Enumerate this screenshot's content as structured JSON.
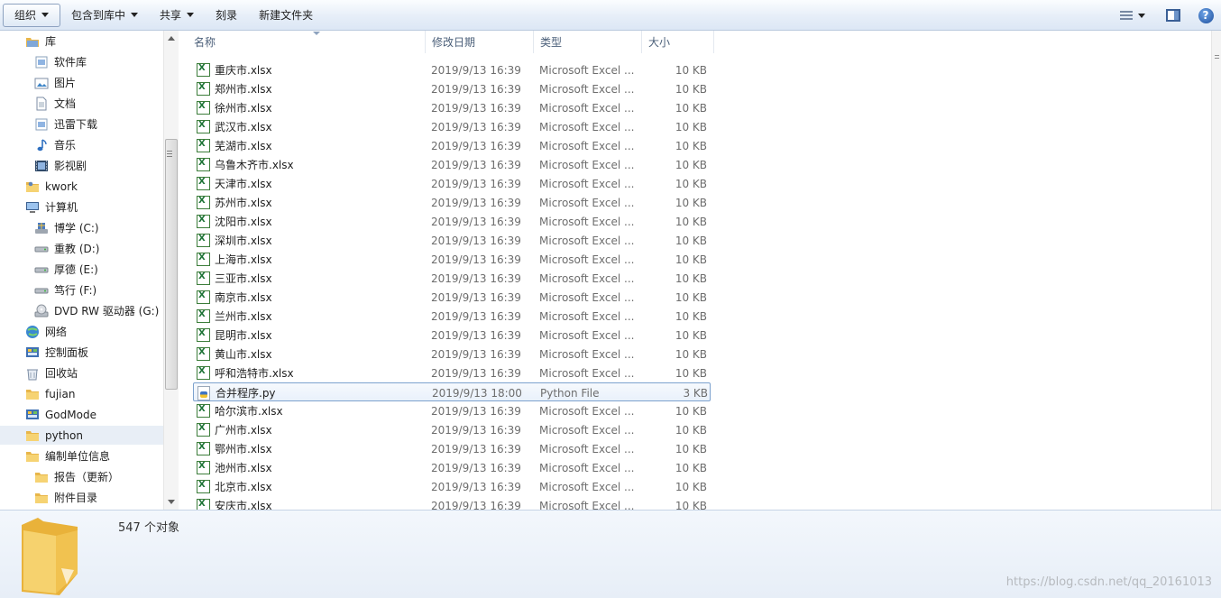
{
  "toolbar": {
    "organize_label": "组织",
    "include_label": "包含到库中",
    "share_label": "共享",
    "burn_label": "刻录",
    "new_folder_label": "新建文件夹",
    "help_label": "?"
  },
  "nav": {
    "items": [
      {
        "label": "库",
        "icon": "library-icon"
      },
      {
        "label": "软件库",
        "icon": "library-folder-icon"
      },
      {
        "label": "图片",
        "icon": "pictures-icon"
      },
      {
        "label": "文档",
        "icon": "documents-icon"
      },
      {
        "label": "迅雷下载",
        "icon": "library-folder-icon"
      },
      {
        "label": "音乐",
        "icon": "music-icon"
      },
      {
        "label": "影视剧",
        "icon": "video-icon"
      },
      {
        "label": "kwork",
        "icon": "user-folder-icon"
      },
      {
        "label": "计算机",
        "icon": "computer-icon"
      },
      {
        "label": "博学 (C:)",
        "icon": "system-drive-icon"
      },
      {
        "label": "重教 (D:)",
        "icon": "drive-icon"
      },
      {
        "label": "厚德 (E:)",
        "icon": "drive-icon"
      },
      {
        "label": "笃行 (F:)",
        "icon": "drive-icon"
      },
      {
        "label": "DVD RW 驱动器 (G:)",
        "icon": "dvd-drive-icon"
      },
      {
        "label": "网络",
        "icon": "network-icon"
      },
      {
        "label": "控制面板",
        "icon": "control-panel-icon"
      },
      {
        "label": "回收站",
        "icon": "recycle-bin-icon"
      },
      {
        "label": "fujian",
        "icon": "folder-icon"
      },
      {
        "label": "GodMode",
        "icon": "control-panel-icon"
      },
      {
        "label": "python",
        "icon": "folder-icon"
      },
      {
        "label": "编制单位信息",
        "icon": "folder-icon"
      },
      {
        "label": "报告（更新）",
        "icon": "folder-icon"
      },
      {
        "label": "附件目录",
        "icon": "folder-icon"
      }
    ]
  },
  "columns": {
    "name": "名称",
    "date": "修改日期",
    "type": "类型",
    "size": "大小"
  },
  "files": [
    {
      "name": "重庆市.xlsx",
      "date": "2019/9/13 16:39",
      "type": "Microsoft Excel ...",
      "size": "10 KB",
      "icon": "excel-file-icon"
    },
    {
      "name": "郑州市.xlsx",
      "date": "2019/9/13 16:39",
      "type": "Microsoft Excel ...",
      "size": "10 KB",
      "icon": "excel-file-icon"
    },
    {
      "name": "徐州市.xlsx",
      "date": "2019/9/13 16:39",
      "type": "Microsoft Excel ...",
      "size": "10 KB",
      "icon": "excel-file-icon"
    },
    {
      "name": "武汉市.xlsx",
      "date": "2019/9/13 16:39",
      "type": "Microsoft Excel ...",
      "size": "10 KB",
      "icon": "excel-file-icon"
    },
    {
      "name": "芜湖市.xlsx",
      "date": "2019/9/13 16:39",
      "type": "Microsoft Excel ...",
      "size": "10 KB",
      "icon": "excel-file-icon"
    },
    {
      "name": "乌鲁木齐市.xlsx",
      "date": "2019/9/13 16:39",
      "type": "Microsoft Excel ...",
      "size": "10 KB",
      "icon": "excel-file-icon"
    },
    {
      "name": "天津市.xlsx",
      "date": "2019/9/13 16:39",
      "type": "Microsoft Excel ...",
      "size": "10 KB",
      "icon": "excel-file-icon"
    },
    {
      "name": "苏州市.xlsx",
      "date": "2019/9/13 16:39",
      "type": "Microsoft Excel ...",
      "size": "10 KB",
      "icon": "excel-file-icon"
    },
    {
      "name": "沈阳市.xlsx",
      "date": "2019/9/13 16:39",
      "type": "Microsoft Excel ...",
      "size": "10 KB",
      "icon": "excel-file-icon"
    },
    {
      "name": "深圳市.xlsx",
      "date": "2019/9/13 16:39",
      "type": "Microsoft Excel ...",
      "size": "10 KB",
      "icon": "excel-file-icon"
    },
    {
      "name": "上海市.xlsx",
      "date": "2019/9/13 16:39",
      "type": "Microsoft Excel ...",
      "size": "10 KB",
      "icon": "excel-file-icon"
    },
    {
      "name": "三亚市.xlsx",
      "date": "2019/9/13 16:39",
      "type": "Microsoft Excel ...",
      "size": "10 KB",
      "icon": "excel-file-icon"
    },
    {
      "name": "南京市.xlsx",
      "date": "2019/9/13 16:39",
      "type": "Microsoft Excel ...",
      "size": "10 KB",
      "icon": "excel-file-icon"
    },
    {
      "name": "兰州市.xlsx",
      "date": "2019/9/13 16:39",
      "type": "Microsoft Excel ...",
      "size": "10 KB",
      "icon": "excel-file-icon"
    },
    {
      "name": "昆明市.xlsx",
      "date": "2019/9/13 16:39",
      "type": "Microsoft Excel ...",
      "size": "10 KB",
      "icon": "excel-file-icon"
    },
    {
      "name": "黄山市.xlsx",
      "date": "2019/9/13 16:39",
      "type": "Microsoft Excel ...",
      "size": "10 KB",
      "icon": "excel-file-icon"
    },
    {
      "name": "呼和浩特市.xlsx",
      "date": "2019/9/13 16:39",
      "type": "Microsoft Excel ...",
      "size": "10 KB",
      "icon": "excel-file-icon"
    },
    {
      "name": "合并程序.py",
      "date": "2019/9/13 18:00",
      "type": "Python File",
      "size": "3 KB",
      "icon": "python-file-icon",
      "selected": true
    },
    {
      "name": "哈尔滨市.xlsx",
      "date": "2019/9/13 16:39",
      "type": "Microsoft Excel ...",
      "size": "10 KB",
      "icon": "excel-file-icon"
    },
    {
      "name": "广州市.xlsx",
      "date": "2019/9/13 16:39",
      "type": "Microsoft Excel ...",
      "size": "10 KB",
      "icon": "excel-file-icon"
    },
    {
      "name": "鄂州市.xlsx",
      "date": "2019/9/13 16:39",
      "type": "Microsoft Excel ...",
      "size": "10 KB",
      "icon": "excel-file-icon"
    },
    {
      "name": "池州市.xlsx",
      "date": "2019/9/13 16:39",
      "type": "Microsoft Excel ...",
      "size": "10 KB",
      "icon": "excel-file-icon"
    },
    {
      "name": "北京市.xlsx",
      "date": "2019/9/13 16:39",
      "type": "Microsoft Excel ...",
      "size": "10 KB",
      "icon": "excel-file-icon"
    },
    {
      "name": "安庆市.xlsx",
      "date": "2019/9/13 16:39",
      "type": "Microsoft Excel ...",
      "size": "10 KB",
      "icon": "excel-file-icon"
    }
  ],
  "status": {
    "count_text": "547 个对象"
  },
  "watermark": "https://blog.csdn.net/qq_20161013",
  "colors": {
    "folder": "#f2c14e",
    "selection_border": "#7da2ce",
    "column_header_text": "#4c607a"
  }
}
